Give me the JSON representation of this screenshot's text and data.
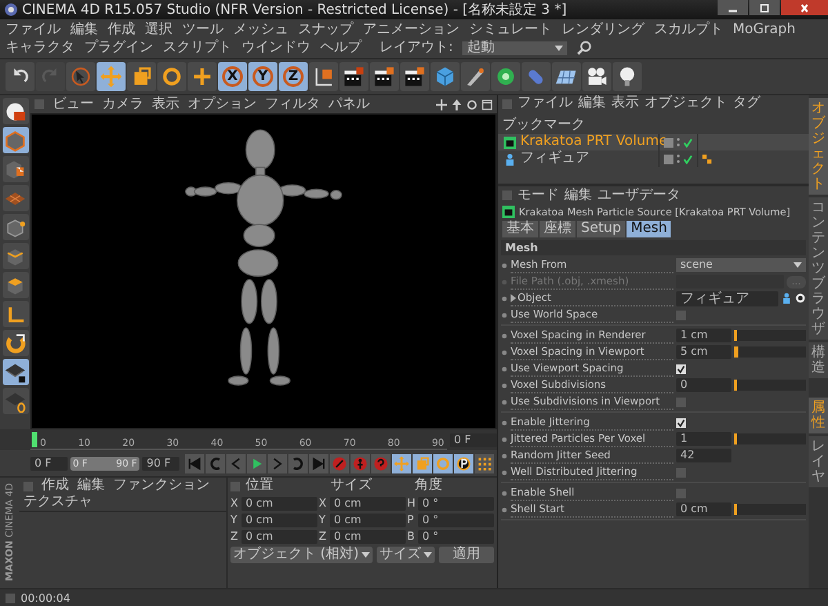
{
  "window": {
    "title": "CINEMA 4D R15.057 Studio (NFR Version - Restricted License) - [名称未設定 3 *]"
  },
  "menu_bar": {
    "items": [
      "ファイル",
      "編集",
      "作成",
      "選択",
      "ツール",
      "メッシュ",
      "スナップ",
      "アニメーション",
      "シミュレート",
      "レンダリング",
      "スカルプト",
      "MoGraph",
      "キャラクタ",
      "プラグイン",
      "スクリプト",
      "ウインドウ",
      "ヘルプ"
    ],
    "layout_label": "レイアウト:",
    "layout_value": "起動"
  },
  "toolbar": [
    {
      "kind": "undo",
      "selected": false,
      "disabled": false
    },
    {
      "kind": "redo",
      "selected": false,
      "disabled": true
    },
    {
      "kind": "select",
      "selected": false,
      "disabled": false
    },
    {
      "kind": "move",
      "selected": true,
      "disabled": false
    },
    {
      "kind": "scale",
      "selected": false,
      "disabled": false
    },
    {
      "kind": "rotate",
      "selected": false,
      "disabled": false
    },
    {
      "kind": "last-tool",
      "selected": false,
      "disabled": false
    },
    {
      "kind": "axis",
      "label": "X",
      "selected": true,
      "disabled": false
    },
    {
      "kind": "axis",
      "label": "Y",
      "selected": true,
      "disabled": false
    },
    {
      "kind": "axis",
      "label": "Z",
      "selected": true,
      "disabled": false
    },
    {
      "kind": "coords",
      "selected": false,
      "disabled": false
    },
    {
      "kind": "render-view",
      "selected": false,
      "disabled": false
    },
    {
      "kind": "render",
      "selected": false,
      "disabled": false
    },
    {
      "kind": "render-settings",
      "selected": false,
      "disabled": false
    },
    {
      "kind": "cube",
      "selected": false,
      "disabled": false
    },
    {
      "kind": "pen",
      "selected": false,
      "disabled": false
    },
    {
      "kind": "subdivide",
      "selected": false,
      "disabled": false
    },
    {
      "kind": "deformer",
      "selected": false,
      "disabled": false
    },
    {
      "kind": "floor",
      "selected": false,
      "disabled": false
    },
    {
      "kind": "camera",
      "selected": false,
      "disabled": false
    },
    {
      "kind": "light",
      "selected": false,
      "disabled": false
    }
  ],
  "left_toolbar": [
    {
      "kind": "display",
      "selected": false
    },
    {
      "kind": "model",
      "selected": true
    },
    {
      "kind": "texture",
      "selected": false
    },
    {
      "kind": "workplane",
      "selected": false
    },
    {
      "kind": "points",
      "selected": false
    },
    {
      "kind": "edges",
      "selected": false
    },
    {
      "kind": "polygons",
      "selected": false
    },
    {
      "kind": "axis-mode",
      "selected": false
    },
    {
      "kind": "snap",
      "selected": false
    },
    {
      "kind": "lock-workplane",
      "selected": true
    },
    {
      "kind": "planar-workplane",
      "selected": false
    }
  ],
  "viewport": {
    "menu": [
      "ビュー",
      "カメラ",
      "表示",
      "オプション",
      "フィルタ",
      "パネル"
    ]
  },
  "timeline": {
    "ticks": [
      "0",
      "10",
      "20",
      "30",
      "40",
      "50",
      "60",
      "70",
      "80",
      "90"
    ],
    "level": 0,
    "end_field": "0 F",
    "start_field": "0 F",
    "range": {
      "start": "0 F",
      "end": "90 F",
      "level": 1
    },
    "max_field": "90 F",
    "transport": [
      {
        "kind": "to-start",
        "selected": false
      },
      {
        "kind": "prev-key",
        "selected": false
      },
      {
        "kind": "prev-frame",
        "selected": false
      },
      {
        "kind": "play",
        "selected": false
      },
      {
        "kind": "next-frame",
        "selected": false
      },
      {
        "kind": "next-key",
        "selected": false
      },
      {
        "kind": "to-end",
        "selected": false
      },
      {
        "kind": "record",
        "selected": false
      },
      {
        "kind": "auto-key",
        "selected": false
      },
      {
        "kind": "key-help",
        "selected": false
      },
      {
        "kind": "key-position",
        "selected": true
      },
      {
        "kind": "key-scale",
        "selected": true
      },
      {
        "kind": "key-rotation",
        "selected": true
      },
      {
        "kind": "key-param",
        "selected": true
      },
      {
        "kind": "key-points",
        "selected": false
      }
    ]
  },
  "material_manager": {
    "menu": [
      "作成",
      "編集",
      "ファンクション",
      "テクスチャ"
    ]
  },
  "coordinates": {
    "headers": [
      "位置",
      "サイズ",
      "角度"
    ],
    "rows": [
      {
        "cells": [
          {
            "axis": "X",
            "value": "0 cm"
          },
          {
            "axis": "X",
            "value": "0 cm"
          },
          {
            "axis": "H",
            "value": "0 °"
          }
        ]
      },
      {
        "cells": [
          {
            "axis": "Y",
            "value": "0 cm"
          },
          {
            "axis": "Y",
            "value": "0 cm"
          },
          {
            "axis": "P",
            "value": "0 °"
          }
        ]
      },
      {
        "cells": [
          {
            "axis": "Z",
            "value": "0 cm"
          },
          {
            "axis": "Z",
            "value": "0 cm"
          },
          {
            "axis": "B",
            "value": "0 °"
          }
        ]
      }
    ],
    "mode_dropdown": "オブジェクト (相対)",
    "size_dropdown": "サイズ",
    "apply_button": "適用"
  },
  "brand": {
    "line_1": "MAXON",
    "line_2": "CINEMA 4D"
  },
  "status_bar": {
    "text": "00:00:04"
  },
  "object_manager": {
    "menu": [
      "ファイル",
      "編集",
      "表示",
      "オブジェクト",
      "タグ",
      "ブックマーク"
    ],
    "objects": [
      {
        "name": "Krakatoa PRT Volume",
        "kind": "krakatoa",
        "selected": true,
        "enabled": true
      },
      {
        "name": "フィギュア",
        "kind": "figure",
        "selected": false,
        "enabled": true,
        "tags": [
          {
            "kind": "figure-tag"
          }
        ]
      }
    ]
  },
  "side_tabs": [
    {
      "label": "オブジェクト",
      "selected": true
    },
    {
      "label": "コンテンツブラウザ",
      "selected": false
    },
    {
      "label": "構造",
      "selected": false
    }
  ],
  "attribute_side_tabs": [
    {
      "label": "属性",
      "selected": true
    },
    {
      "label": "レイヤ",
      "selected": false
    }
  ],
  "attributes": {
    "menu": [
      "モード",
      "編集",
      "ユーザデータ"
    ],
    "title": "Krakatoa Mesh Particle Source [Krakatoa PRT Volume]",
    "tabs": [
      {
        "label": "基本",
        "selected": false
      },
      {
        "label": "座標",
        "selected": false
      },
      {
        "label": "Setup",
        "selected": false
      },
      {
        "label": "Mesh",
        "selected": true
      }
    ],
    "section": "Mesh",
    "groups": [
      {
        "rows": [
          {
            "label": "Mesh From",
            "kind": "dropdown",
            "value": "scene",
            "disabled": false
          },
          {
            "label": "File Path (.obj, .xmesh)",
            "kind": "file",
            "button": "...",
            "disabled": true
          },
          {
            "label": "Object",
            "kind": "link",
            "value": "フィギュア",
            "disabled": false
          },
          {
            "label": "Use World Space",
            "kind": "checkbox",
            "checked": false,
            "disabled": false
          }
        ]
      },
      {
        "rows": [
          {
            "label": "Voxel Spacing in Renderer",
            "kind": "slider",
            "value": "1 cm",
            "level": 0.01,
            "disabled": false
          },
          {
            "label": "Voxel Spacing in Viewport",
            "kind": "slider",
            "value": "5 cm",
            "level": 0.05,
            "disabled": false
          },
          {
            "label": "Use Viewport Spacing",
            "kind": "checkbox",
            "checked": true,
            "disabled": false
          },
          {
            "label": "Voxel Subdivisions",
            "kind": "slider",
            "value": "0",
            "level": 0,
            "disabled": false
          },
          {
            "label": "Use Subdivisions in Viewport",
            "kind": "checkbox",
            "checked": false,
            "disabled": false
          }
        ]
      },
      {
        "rows": [
          {
            "label": "Enable Jittering",
            "kind": "checkbox",
            "checked": true,
            "disabled": false
          },
          {
            "label": "Jittered Particles Per Voxel",
            "kind": "slider",
            "value": "1",
            "level": 0,
            "disabled": false
          },
          {
            "label": "Random Jitter Seed",
            "kind": "number",
            "value": "42",
            "disabled": false
          },
          {
            "label": "Well Distributed Jittering",
            "kind": "checkbox",
            "checked": false,
            "disabled": false
          }
        ]
      },
      {
        "rows": [
          {
            "label": "Enable Shell",
            "kind": "checkbox",
            "checked": false,
            "disabled": false
          },
          {
            "label": "Shell Start",
            "kind": "slider",
            "value": "0 cm",
            "level": 0,
            "disabled": false
          }
        ]
      }
    ]
  }
}
